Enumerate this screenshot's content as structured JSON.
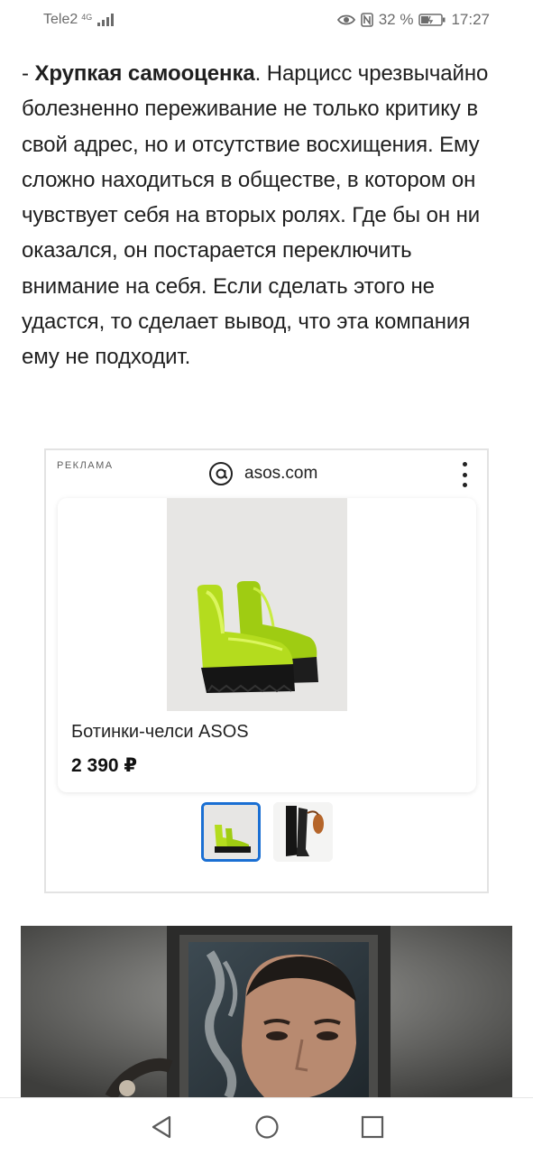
{
  "status_bar": {
    "carrier": "Tele2",
    "network": "4G",
    "battery_percent": "32 %",
    "time": "17:27",
    "icons": [
      "signal-icon",
      "eye-icon",
      "nfc-icon",
      "battery-icon"
    ]
  },
  "article": {
    "lead_dash": "- ",
    "bold_heading": "Хрупкая самооценка",
    "body": ". Нарцисс чрезвычайно болезненно переживание не только критику в свой адрес, но и отсутствие восхищения. Ему сложно находиться в обществе, в котором он чувствует себя на вторых ролях. Где бы он ни оказался, он постарается переключить внимание на себя. Если сделать этого не удастся, то сделает вывод, что эта компания ему не подходит."
  },
  "ad": {
    "label": "РЕКЛАМА",
    "source": "asos.com",
    "product": {
      "name": "Ботинки-челси ASOS",
      "price": "2 390 ₽"
    },
    "thumbnails": [
      {
        "name": "green-boots-thumb",
        "active": true
      },
      {
        "name": "black-boots-thumb",
        "active": false
      }
    ]
  },
  "colors": {
    "accent_thumb_border": "#1a6fd3",
    "boot_green": "#b4dc1e",
    "text": "#1f1f1f"
  },
  "nav_bar": {
    "icons": [
      "back-icon",
      "home-icon",
      "recents-icon"
    ]
  }
}
